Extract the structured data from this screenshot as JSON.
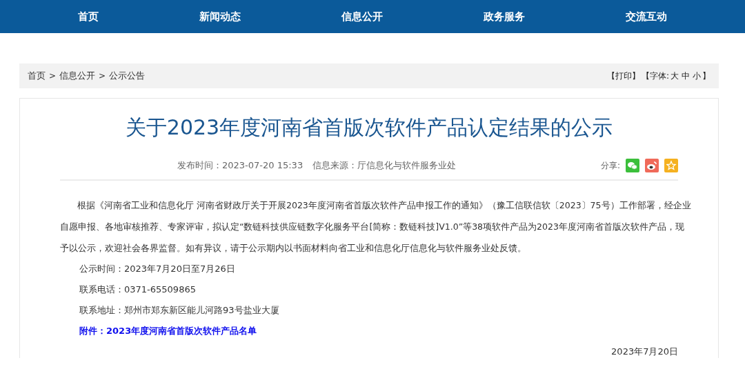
{
  "nav": [
    {
      "label": "首页",
      "selected": false
    },
    {
      "label": "新闻动态",
      "selected": false
    },
    {
      "label": "信息公开",
      "selected": false
    },
    {
      "label": "政务服务",
      "selected": false
    },
    {
      "label": "交流互动",
      "selected": false
    }
  ],
  "breadcrumb": {
    "items": [
      "首页",
      "信息公开",
      "公示公告"
    ],
    "separator": ">"
  },
  "tools": {
    "print": "【打印】",
    "font_label": "【字体:",
    "sizes": [
      "大",
      "中",
      "小"
    ],
    "close": "】"
  },
  "article": {
    "title": "关于2023年度河南省首版次软件产品认定结果的公示",
    "published": "发布时间：2023-07-20 15:33",
    "source": "信息来源：厅信息化与软件服务业处",
    "share_label": "分享:",
    "body": "根据《河南省工业和信息化厅 河南省财政厅关于开展2023年度河南省首版次软件产品申报工作的通知》（豫工信联信软〔2023〕75号）工作部署，经企业自愿申报、各地审核推荐、专家评审，拟认定“数链科技供应链数字化服务平台[简称：数链科技]V1.0”等38项软件产品为2023年度河南省首版次软件产品，现予以公示，欢迎社会各界监督。如有异议，请于公示期内以书面材料向省工业和信息化厅信息化与软件服务业处反馈。",
    "details": [
      "公示时间：2023年7月20日至7月26日",
      "联系电话：0371-65509865",
      "联系地址：郑州市郑东新区能儿河路93号盐业大厦"
    ],
    "attachment": "附件：2023年度河南省首版次软件产品名单",
    "date": "2023年7月20日"
  }
}
